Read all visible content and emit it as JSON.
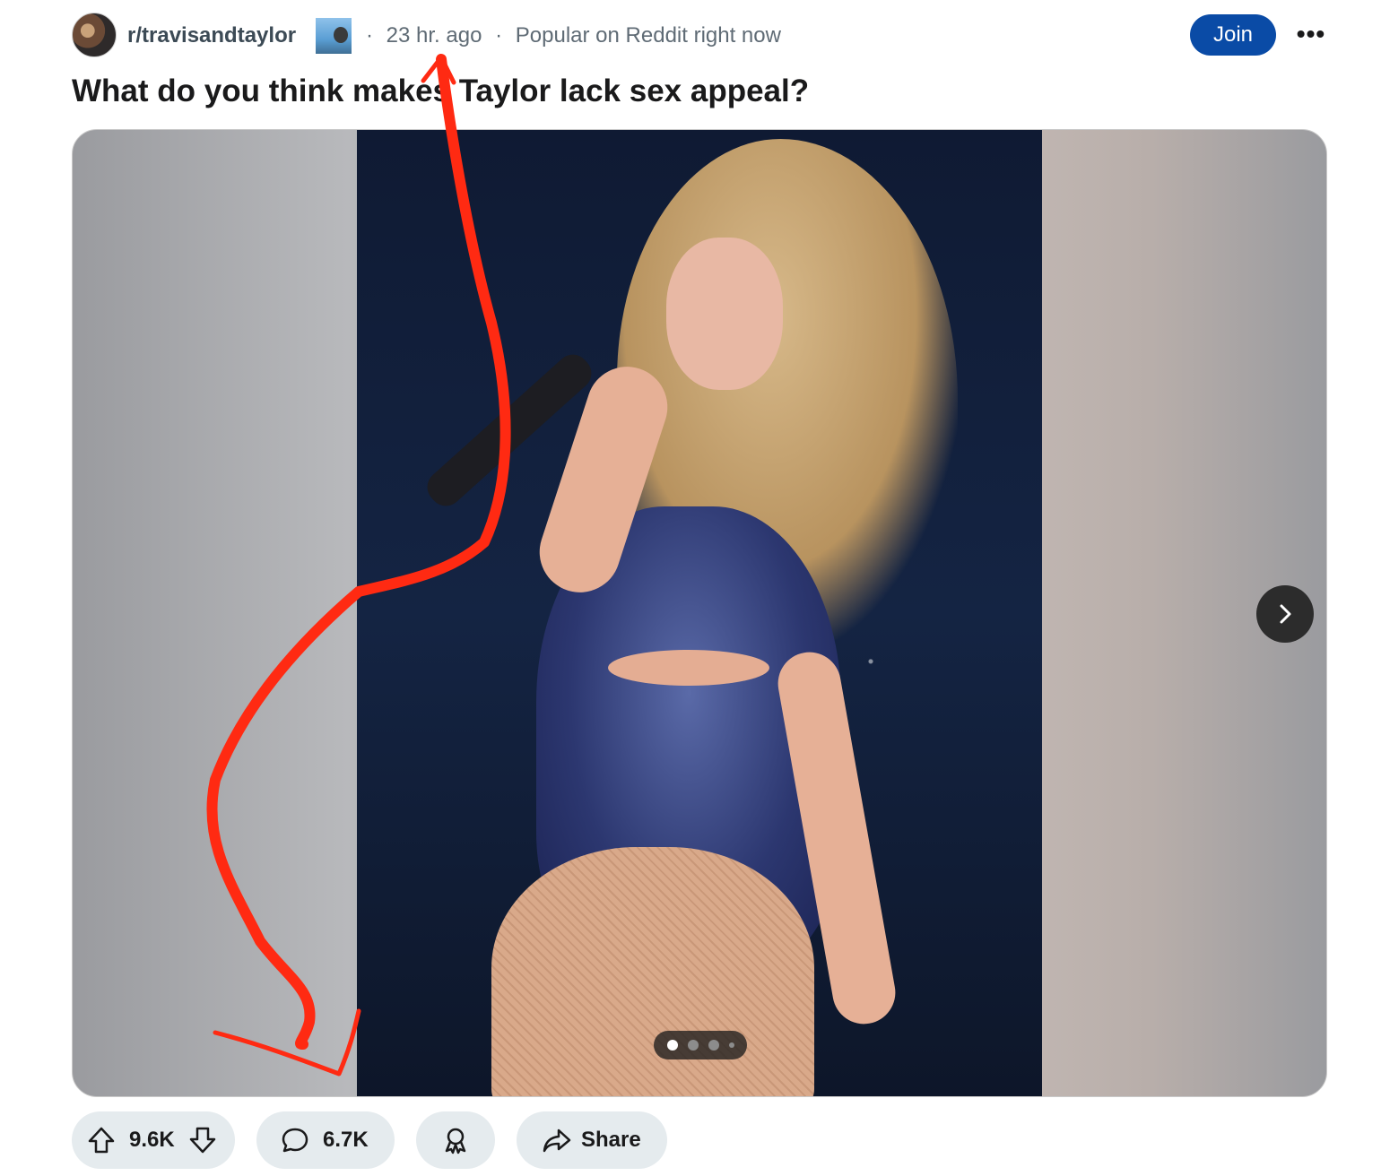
{
  "post": {
    "subreddit": "r/travisandtaylor",
    "time": "23 hr. ago",
    "popular": "Popular on Reddit right now",
    "join_label": "Join",
    "more_label": "•••",
    "title": "What do you think makes Taylor lack sex appeal?"
  },
  "carousel": {
    "total": 4,
    "active_index": 0
  },
  "actions": {
    "votes": "9.6K",
    "comments": "6.7K",
    "share_label": "Share"
  },
  "icons": {
    "upvote": "arrow-up-icon",
    "downvote": "arrow-down-icon",
    "comment": "speech-bubble-icon",
    "award": "award-ribbon-icon",
    "share": "share-arrow-icon",
    "next": "chevron-right-icon"
  },
  "colors": {
    "join_button": "#0a4ba6",
    "action_pill": "#e5ebee",
    "annotation": "#ff2a12"
  }
}
